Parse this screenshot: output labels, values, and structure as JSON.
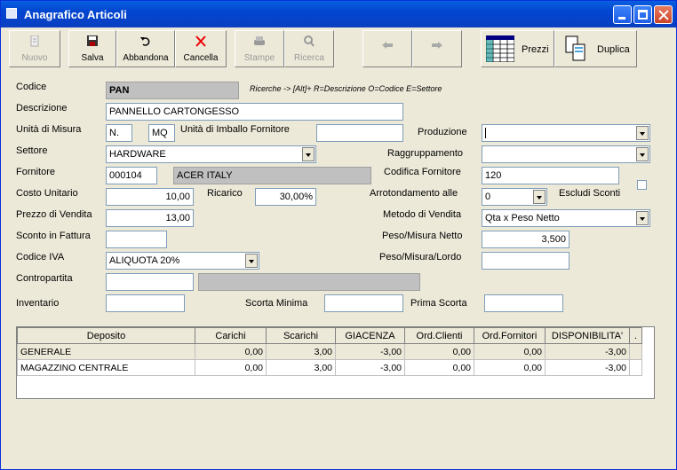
{
  "window": {
    "title": "Anagrafico Articoli"
  },
  "toolbar": {
    "nuovo": "Nuovo",
    "salva": "Salva",
    "abbandona": "Abbandona",
    "cancella": "Cancella",
    "stampe": "Stampe",
    "ricerca": "Ricerca",
    "prezzi": "Prezzi",
    "duplica": "Duplica"
  },
  "form": {
    "codice_label": "Codice",
    "codice": "PAN",
    "hint": "Ricerche -> [Alt]+ R=Descrizione O=Codice E=Settore",
    "descrizione_label": "Descrizione",
    "descrizione": "PANNELLO CARTONGESSO",
    "unita_label": "Unità di Misura",
    "unita1": "N.",
    "unita2": "MQ",
    "imballo_label": "Unità di Imballo Fornitore",
    "imballo": "",
    "produzione_label": "Produzione",
    "produzione": "",
    "settore_label": "Settore",
    "settore": "HARDWARE",
    "raggruppamento_label": "Raggruppamento",
    "raggruppamento": "",
    "fornitore_label": "Fornitore",
    "fornitore_code": "000104",
    "fornitore_name": "ACER ITALY",
    "codifica_label": "Codifica Fornitore",
    "codifica": "120",
    "costo_label": "Costo Unitario",
    "costo": "10,00",
    "ricarico_label": "Ricarico",
    "ricarico": "30,00%",
    "arrotondamento_label": "Arrotondamento alle",
    "arrotondamento": "0",
    "escludi_label": "Escludi Sconti",
    "prezzo_label": "Prezzo di Vendita",
    "prezzo": "13,00",
    "metodo_label": "Metodo di Vendita",
    "metodo": "Qta x Peso Netto",
    "sconto_label": "Sconto in Fattura",
    "sconto": "",
    "peso_netto_label": "Peso/Misura Netto",
    "peso_netto": "3,500",
    "iva_label": "Codice IVA",
    "iva": "ALIQUOTA 20%",
    "peso_lordo_label": "Peso/Misura/Lordo",
    "peso_lordo": "",
    "contropartita_label": "Contropartita",
    "contropartita": "",
    "inventario_label": "Inventario",
    "inventario": "",
    "scorta_min_label": "Scorta Minima",
    "scorta_min": "",
    "prima_scorta_label": "Prima Scorta",
    "prima_scorta": ""
  },
  "grid": {
    "headers": [
      "Deposito",
      "Carichi",
      "Scarichi",
      "GIACENZA",
      "Ord.Clienti",
      "Ord.Fornitori",
      "DISPONIBILITA'",
      "."
    ],
    "rows": [
      [
        "GENERALE",
        "0,00",
        "3,00",
        "-3,00",
        "0,00",
        "0,00",
        "-3,00"
      ],
      [
        "MAGAZZINO CENTRALE",
        "0,00",
        "3,00",
        "-3,00",
        "0,00",
        "0,00",
        "-3,00"
      ]
    ]
  }
}
